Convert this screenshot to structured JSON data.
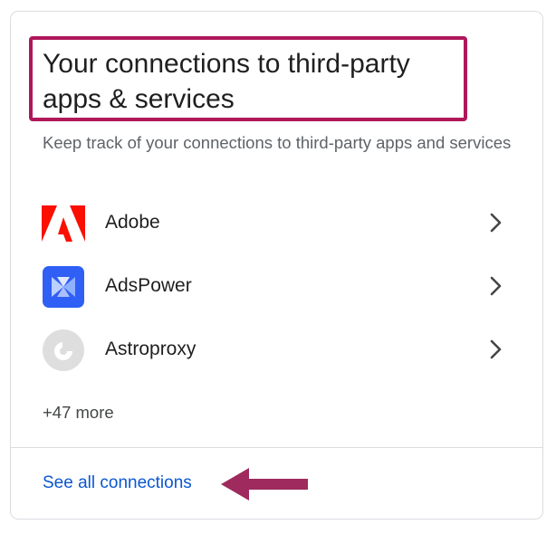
{
  "card": {
    "title": "Your connections to third-party apps & services",
    "subtitle": "Keep track of your connections to third-party apps and services",
    "connections": [
      {
        "name": "Adobe",
        "icon": "adobe-logo-icon",
        "color": "#fa0f00"
      },
      {
        "name": "AdsPower",
        "icon": "adspower-logo-icon",
        "color": "#2f5ff5"
      },
      {
        "name": "Astroproxy",
        "icon": "astroproxy-logo-icon",
        "color": "#d9d9d9"
      }
    ],
    "more_label": "+47 more",
    "see_all_label": "See all connections"
  },
  "annotations": {
    "highlight_color": "#b0175a",
    "arrow_color": "#9e2a5e",
    "arrow_icon": "left-arrow-icon"
  },
  "colors": {
    "link": "#0b57d0",
    "text": "#1f1f1f",
    "secondary_text": "#5f6368",
    "divider": "#dadce0"
  }
}
